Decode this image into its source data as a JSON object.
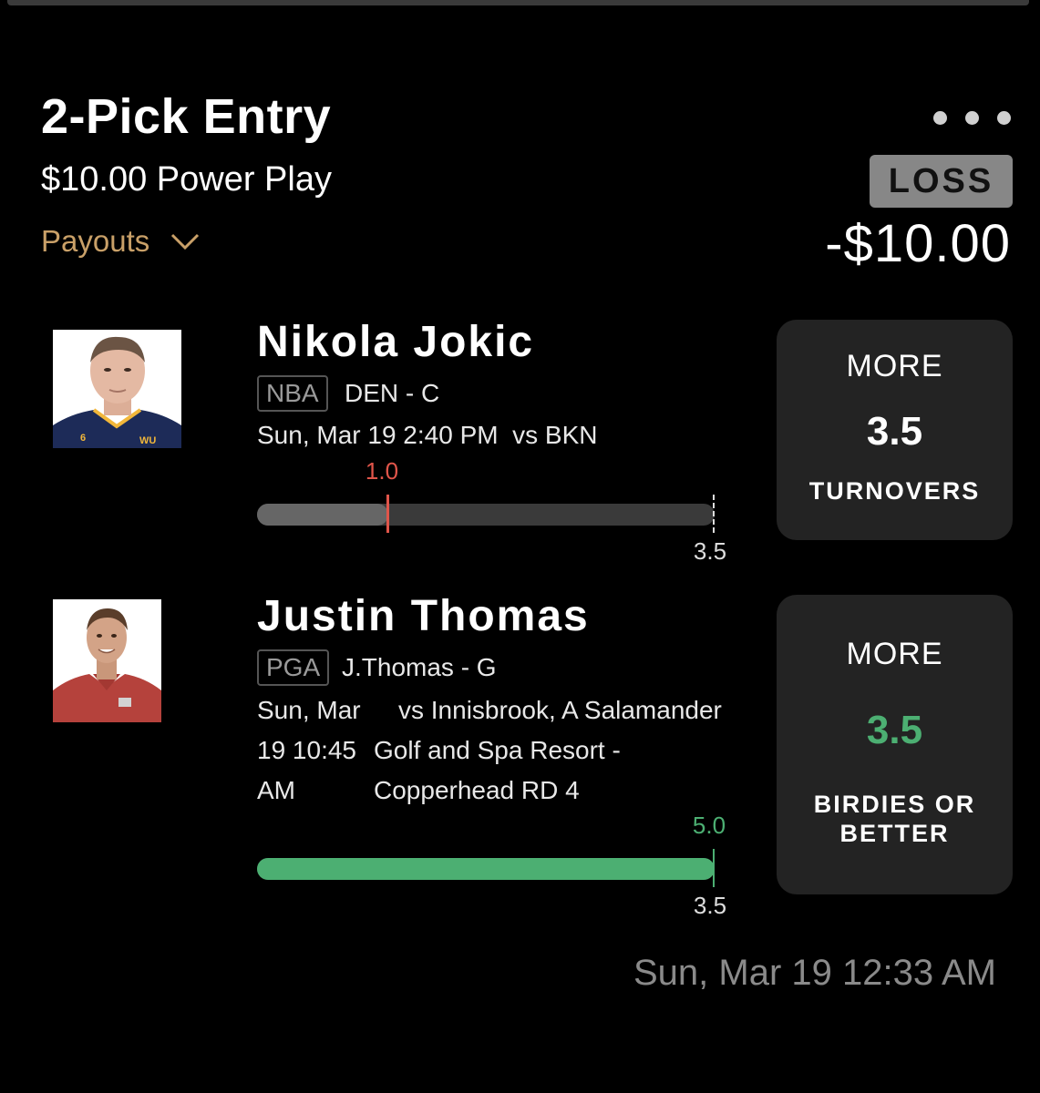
{
  "entry": {
    "title": "2-Pick Entry",
    "subtitle": "$10.00 Power Play",
    "payouts_label": "Payouts",
    "result": "LOSS",
    "amount": "-$10.00",
    "timestamp": "Sun, Mar 19 12:33 AM"
  },
  "colors": {
    "loss_red": "#e0554a",
    "win_green": "#4caf72",
    "gold": "#c9a068",
    "card_bg": "#232323"
  },
  "picks": [
    {
      "player": "Nikola Jokic",
      "league": "NBA",
      "team_pos": "DEN - C",
      "game_time": "Sun, Mar 19 2:40 PM",
      "opponent": "vs BKN",
      "actual": "1.0",
      "line": "3.5",
      "progress": 0.286,
      "direction": "MORE",
      "stat": "TURNOVERS",
      "hit": false
    },
    {
      "player": "Justin Thomas",
      "league": "PGA",
      "team_pos": "J.Thomas - G",
      "game_time_lines": [
        "Sun, Mar",
        "19 10:45",
        "AM"
      ],
      "opponent_lines": [
        "vs Innisbrook, A Salamander",
        "Golf and Spa Resort -",
        "Copperhead RD 4"
      ],
      "actual": "5.0",
      "line": "3.5",
      "progress": 1.0,
      "direction": "MORE",
      "stat_lines": [
        "BIRDIES OR",
        "BETTER"
      ],
      "hit": true
    }
  ]
}
